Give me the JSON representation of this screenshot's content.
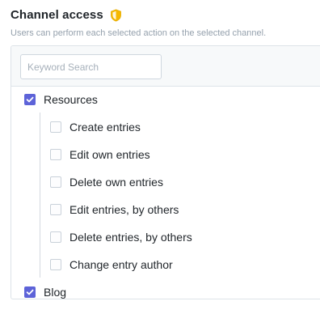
{
  "section": {
    "title": "Channel access",
    "description": "Users can perform each selected action on the selected channel."
  },
  "search": {
    "placeholder": "Keyword Search",
    "value": ""
  },
  "groups": [
    {
      "label": "Resources",
      "checked": true,
      "children": [
        {
          "label": "Create entries",
          "checked": false
        },
        {
          "label": "Edit own entries",
          "checked": false
        },
        {
          "label": "Delete own entries",
          "checked": false
        },
        {
          "label": "Edit entries, by others",
          "checked": false
        },
        {
          "label": "Delete entries, by others",
          "checked": false
        },
        {
          "label": "Change entry author",
          "checked": false
        }
      ]
    },
    {
      "label": "Blog",
      "checked": true
    }
  ],
  "colors": {
    "accent": "#5d63d8",
    "shield": "#f5b800"
  },
  "icons": {
    "section_icon": "shield-icon",
    "check_icon": "checkmark-icon"
  }
}
